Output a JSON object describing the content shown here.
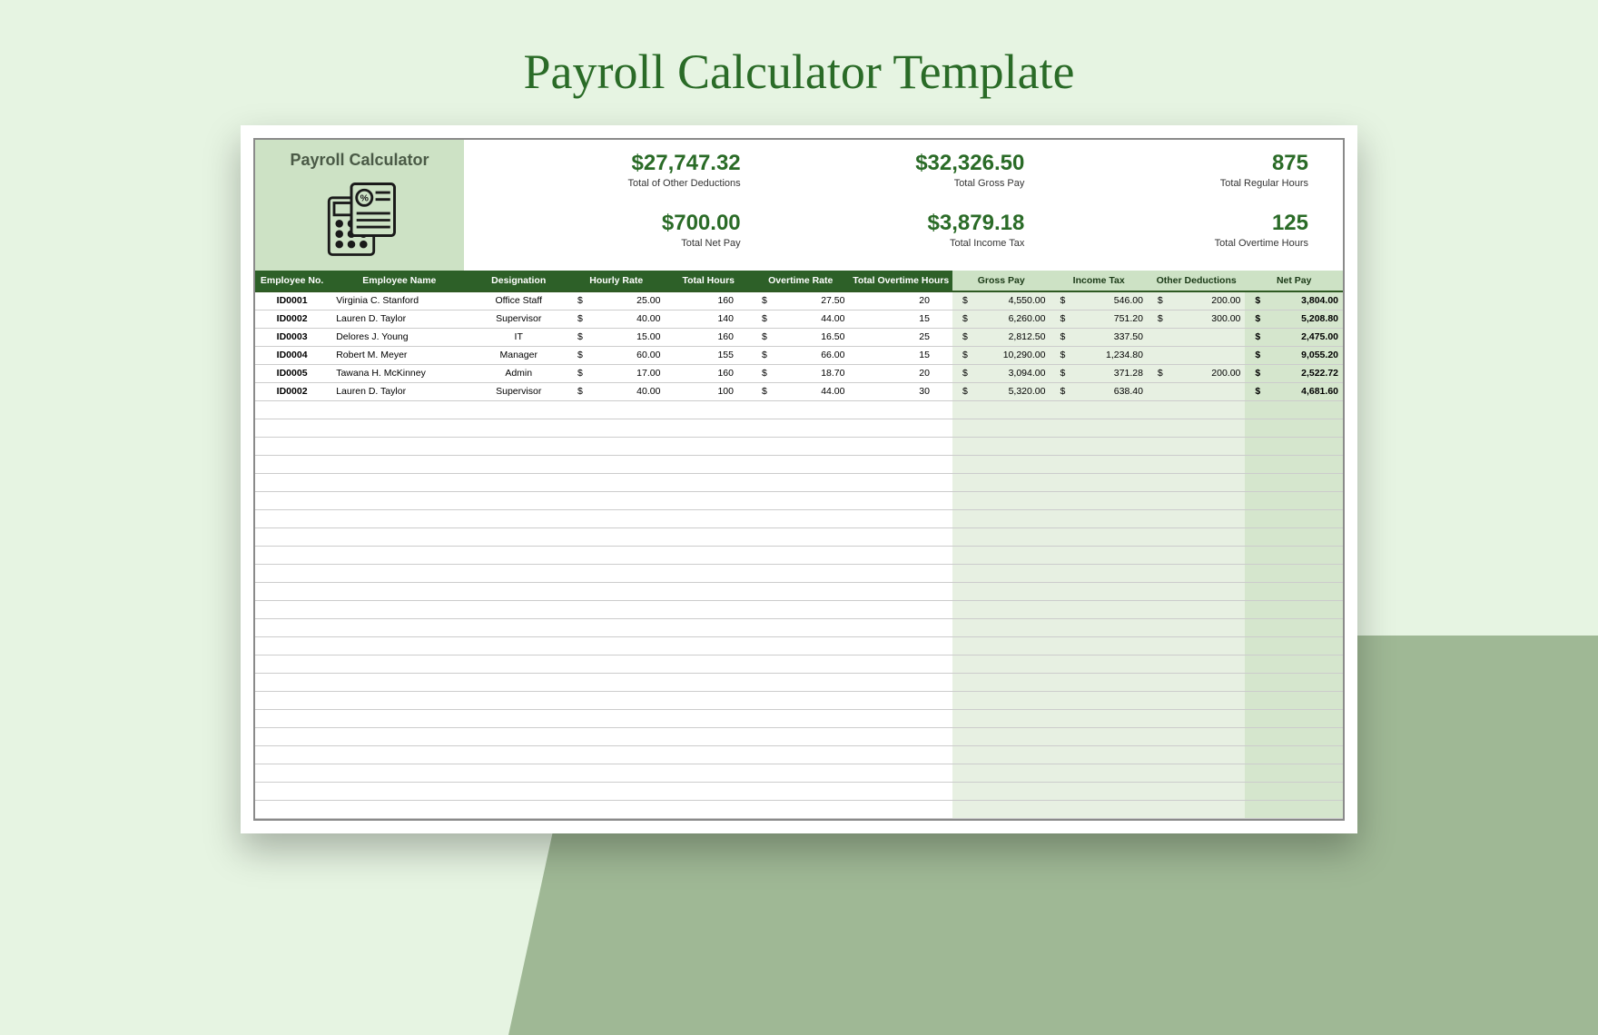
{
  "page": {
    "title": "Payroll Calculator Template"
  },
  "brand": {
    "label": "Payroll Calculator"
  },
  "summary": {
    "r1": [
      {
        "value": "$27,747.32",
        "label": "Total of Other Deductions"
      },
      {
        "value": "$32,326.50",
        "label": "Total Gross Pay"
      },
      {
        "value": "875",
        "label": "Total Regular Hours"
      }
    ],
    "r2": [
      {
        "value": "$700.00",
        "label": "Total Net Pay"
      },
      {
        "value": "$3,879.18",
        "label": "Total Income Tax"
      },
      {
        "value": "125",
        "label": "Total Overtime Hours"
      }
    ]
  },
  "table": {
    "headers": {
      "emp_no": "Employee No.",
      "name": "Employee Name",
      "desg": "Designation",
      "rate": "Hourly Rate",
      "hours": "Total Hours",
      "otrate": "Overtime Rate",
      "othours": "Total Overtime Hours",
      "gross": "Gross Pay",
      "tax": "Income Tax",
      "ded": "Other Deductions",
      "net": "Net Pay"
    },
    "rows": [
      {
        "emp": "ID0001",
        "name": "Virginia C. Stanford",
        "desg": "Office Staff",
        "rate": "25.00",
        "hours": "160",
        "otrate": "27.50",
        "othours": "20",
        "gross": "4,550.00",
        "tax": "546.00",
        "ded": "200.00",
        "net": "3,804.00"
      },
      {
        "emp": "ID0002",
        "name": "Lauren D. Taylor",
        "desg": "Supervisor",
        "rate": "40.00",
        "hours": "140",
        "otrate": "44.00",
        "othours": "15",
        "gross": "6,260.00",
        "tax": "751.20",
        "ded": "300.00",
        "net": "5,208.80"
      },
      {
        "emp": "ID0003",
        "name": "Delores J. Young",
        "desg": "IT",
        "rate": "15.00",
        "hours": "160",
        "otrate": "16.50",
        "othours": "25",
        "gross": "2,812.50",
        "tax": "337.50",
        "ded": "",
        "net": "2,475.00"
      },
      {
        "emp": "ID0004",
        "name": "Robert M. Meyer",
        "desg": "Manager",
        "rate": "60.00",
        "hours": "155",
        "otrate": "66.00",
        "othours": "15",
        "gross": "10,290.00",
        "tax": "1,234.80",
        "ded": "",
        "net": "9,055.20"
      },
      {
        "emp": "ID0005",
        "name": "Tawana H. McKinney",
        "desg": "Admin",
        "rate": "17.00",
        "hours": "160",
        "otrate": "18.70",
        "othours": "20",
        "gross": "3,094.00",
        "tax": "371.28",
        "ded": "200.00",
        "net": "2,522.72"
      },
      {
        "emp": "ID0002",
        "name": "Lauren D. Taylor",
        "desg": "Supervisor",
        "rate": "40.00",
        "hours": "100",
        "otrate": "44.00",
        "othours": "30",
        "gross": "5,320.00",
        "tax": "638.40",
        "ded": "",
        "net": "4,681.60"
      }
    ]
  },
  "cur": "$"
}
